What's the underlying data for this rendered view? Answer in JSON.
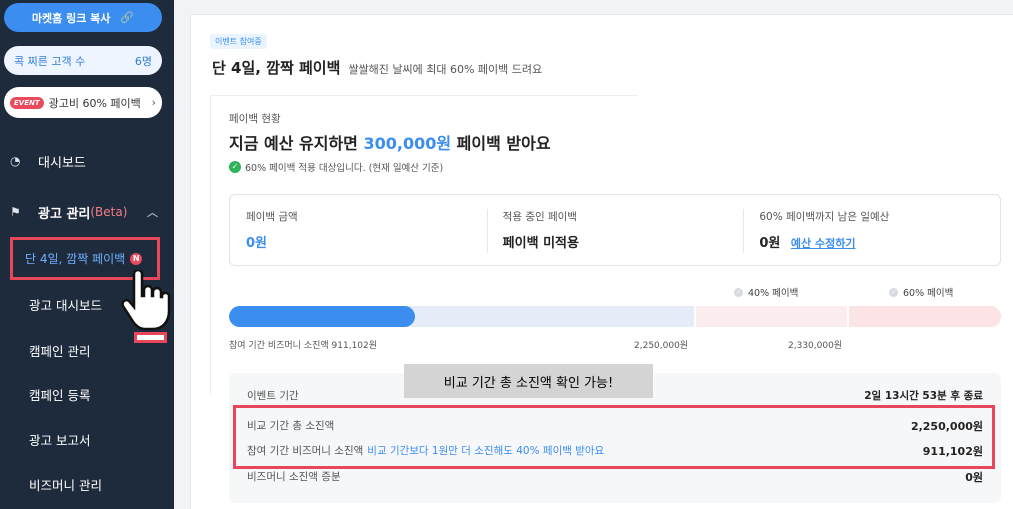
{
  "sidebar": {
    "copy_link_label": "마켓홈 링크 복사",
    "customers_label": "콕 찌른 고객 수",
    "customers_count": "6명",
    "event_badge": "EVENT",
    "event_label": "광고비 60% 페이백",
    "dashboard_label": "대시보드",
    "ads_label": "광고 관리",
    "ads_beta": "(Beta)",
    "submenu": [
      {
        "label": "단 4일, 깜짝 페이백",
        "badge": "N"
      },
      {
        "label": "광고 대시보드"
      },
      {
        "label": "캠페인 관리"
      },
      {
        "label": "캠페인 등록"
      },
      {
        "label": "광고 보고서"
      },
      {
        "label": "비즈머니 관리"
      }
    ]
  },
  "main": {
    "tag": "이벤트 참여중",
    "title": "단 4일, 깜짝 페이백",
    "subtitle": "쌀쌀해진 날씨에 최대 60% 페이백 드려요",
    "status_label": "페이백 현황",
    "headline_prefix": "지금 예산 유지하면 ",
    "headline_amount": "300,000원",
    "headline_suffix": " 페이백 받아요",
    "check_text": "60% 페이백 적용 대상입니다. (현재 일예산 기준)",
    "stats": {
      "amount_label": "페이백 금액",
      "amount_value": "0원",
      "applied_label": "적용 중인 페이백",
      "applied_value": "페이백 미적용",
      "remaining_label": "60% 페이백까지 남은 일예산",
      "remaining_value": "0원",
      "edit_link": "예산 수정하기"
    },
    "tiers": {
      "t40": "40% 페이백",
      "t60": "60% 페이백"
    },
    "progress": {
      "spend_label": "참여 기간 비즈머니 소진액 911,102원",
      "mark_a": "2,250,000원",
      "mark_b": "2,330,000원",
      "fill_fraction": 0.4
    },
    "tooltip": "비교 기간 총 소진액 확인 가능!",
    "table": {
      "period_label": "이벤트 기간",
      "period_value": "2일 13시간 53분 후 종료",
      "compare_label": "비교 기간 총 소진액",
      "compare_value": "2,250,000원",
      "spend_label": "참여 기간 비즈머니 소진액",
      "spend_note": "비교 기간보다 1원만 더 소진해도 40% 페이백 받아요",
      "spend_value": "911,102원",
      "increase_label": "비즈머니 소진액 증분",
      "increase_value": "0원"
    }
  },
  "colors": {
    "accent": "#3b8ef0",
    "highlight": "#e8465a",
    "sidebar": "#1e2b3c"
  }
}
